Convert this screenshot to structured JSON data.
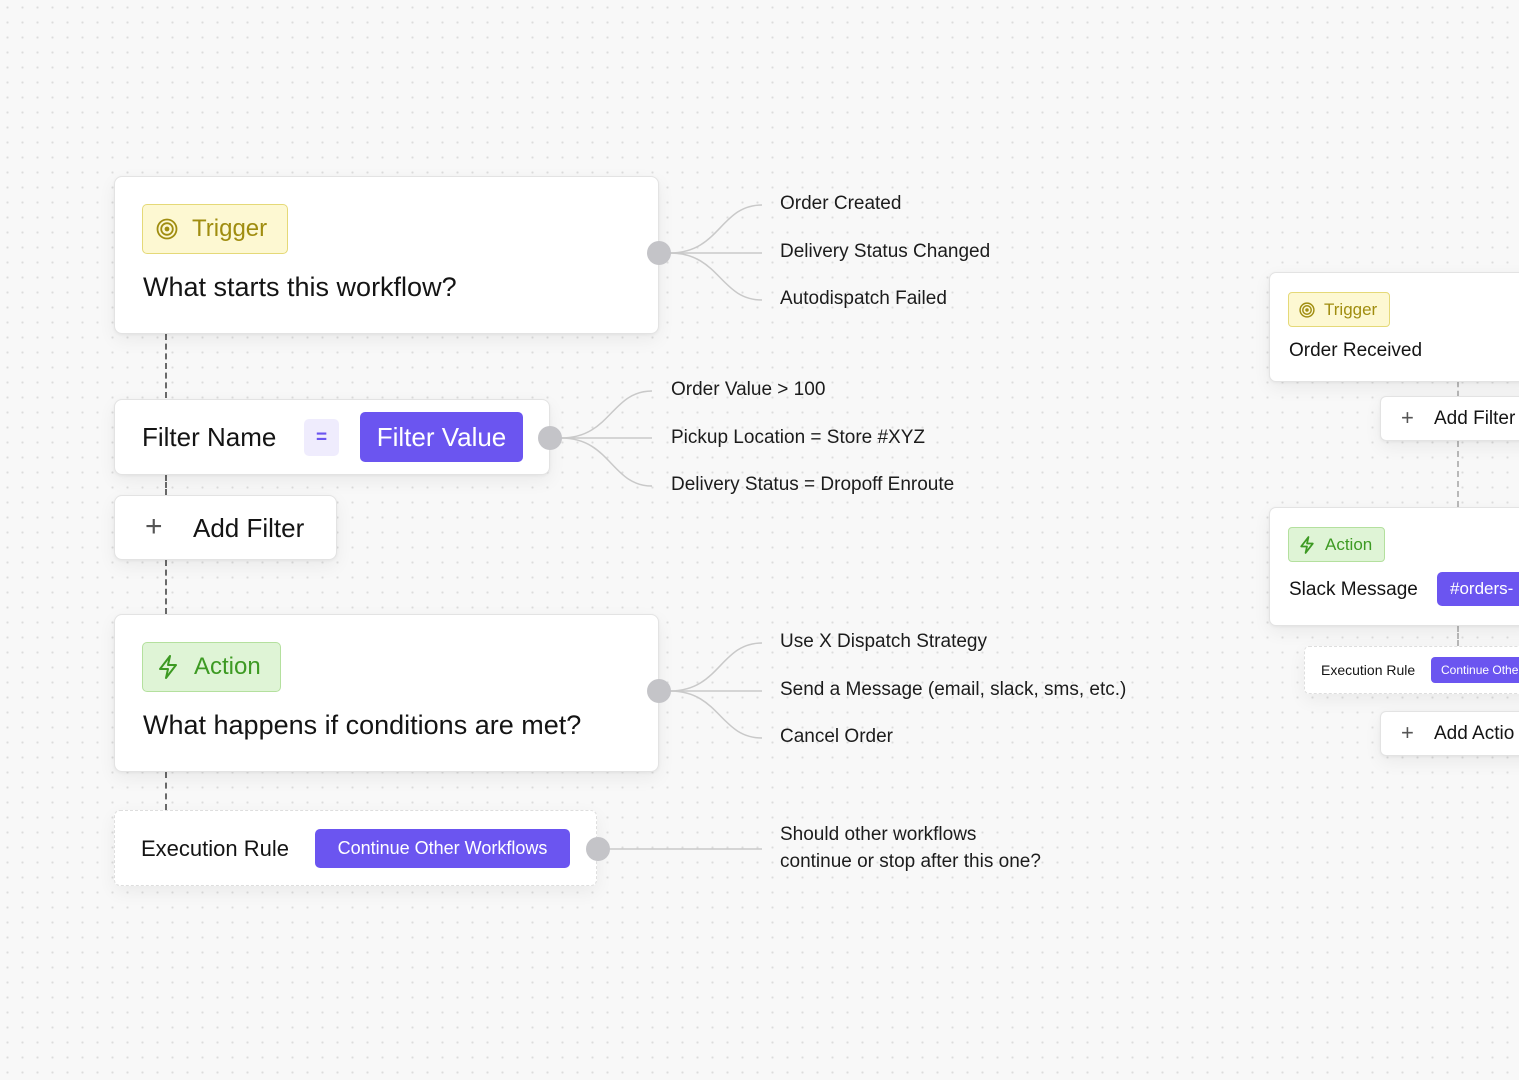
{
  "main_flow": {
    "trigger_card": {
      "badge": "Trigger",
      "badge_icon": "target-icon",
      "title": "What starts this workflow?",
      "options": [
        "Order Created",
        "Delivery Status Changed",
        "Autodispatch Failed"
      ]
    },
    "filter_card": {
      "name": "Filter Name",
      "operator": "=",
      "value": "Filter Value",
      "options": [
        "Order Value > 100",
        "Pickup Location = Store #XYZ",
        "Delivery Status = Dropoff Enroute"
      ]
    },
    "add_filter": {
      "icon": "plus-icon",
      "label": "Add Filter"
    },
    "action_card": {
      "badge": "Action",
      "badge_icon": "lightning-icon",
      "title": "What happens if conditions are met?",
      "options": [
        "Use X Dispatch Strategy",
        "Send a Message (email, slack, sms, etc.)",
        "Cancel Order"
      ]
    },
    "execution_rule": {
      "label": "Execution Rule",
      "value": "Continue Other Workflows",
      "description_line1": "Should other workflows",
      "description_line2": "continue or stop after this one?"
    }
  },
  "example_flow": {
    "trigger_card": {
      "badge": "Trigger",
      "title": "Order Received"
    },
    "add_filter": {
      "label": "Add Filter"
    },
    "action_card": {
      "badge": "Action",
      "title": "Slack Message",
      "pill": "#orders-"
    },
    "execution_rule": {
      "label": "Execution Rule",
      "value": "Continue Othe"
    },
    "add_action": {
      "label": "Add Actio"
    }
  },
  "colors": {
    "accent": "#6b55f0",
    "trigger_bg": "#fdf8d2",
    "trigger_text": "#a08d10",
    "action_bg": "#dff4d6",
    "action_text": "#3d9a23",
    "connector": "#c9c9c9"
  }
}
